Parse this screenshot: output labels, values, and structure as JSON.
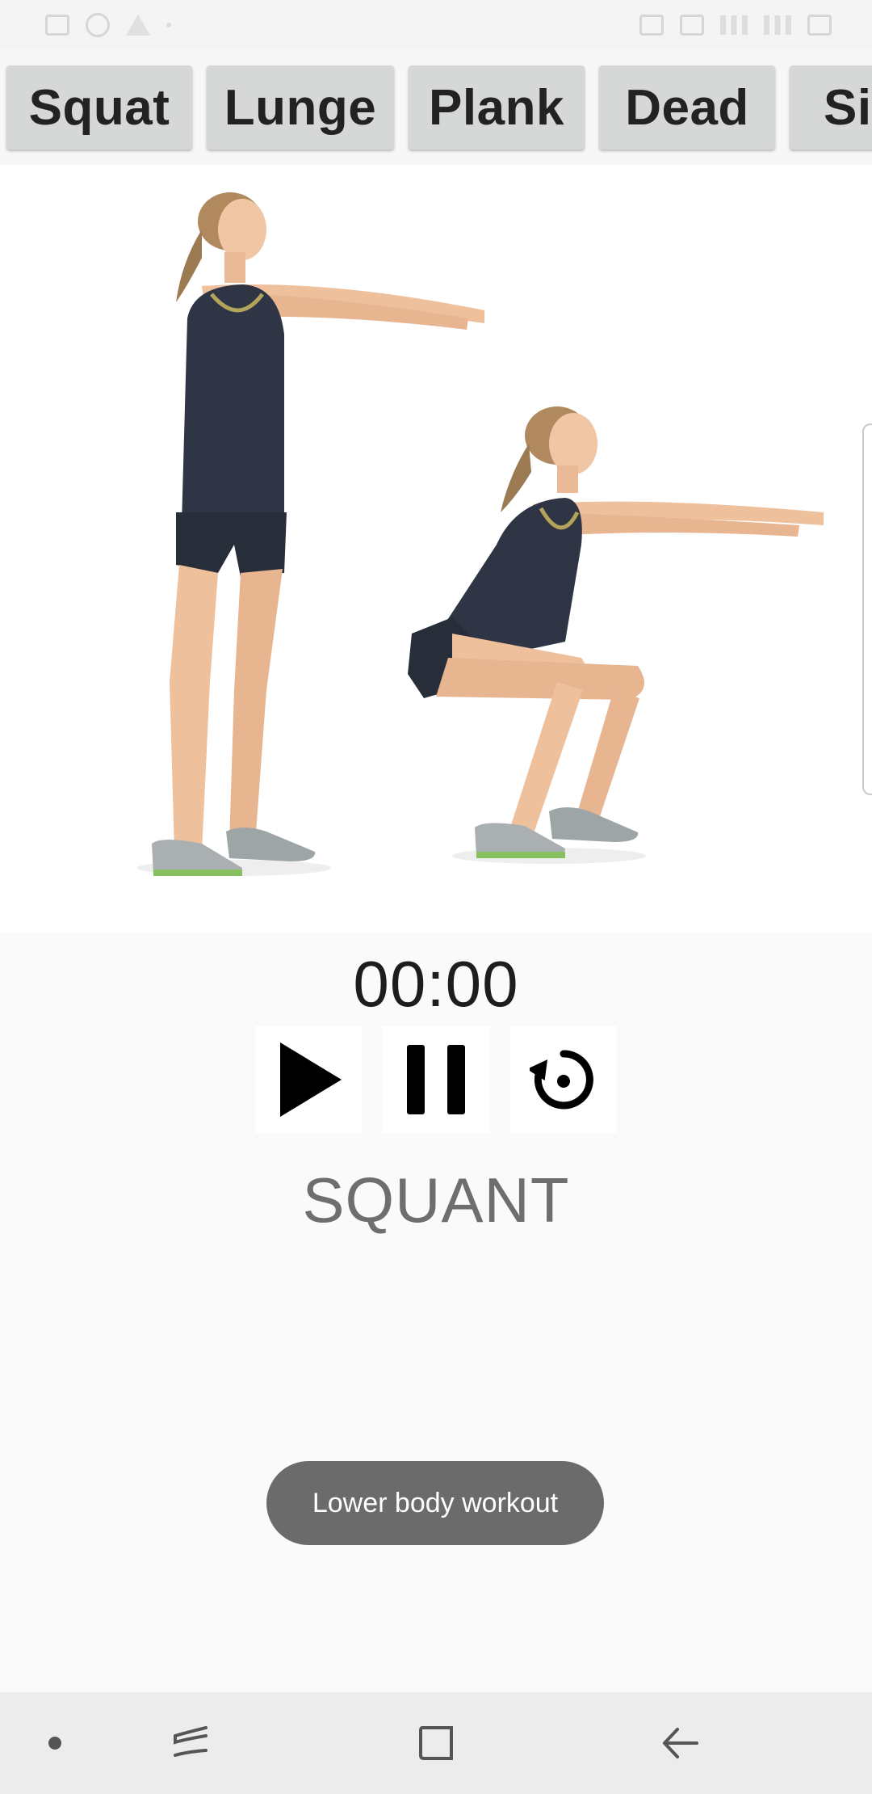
{
  "tabs": [
    {
      "label": "Squat"
    },
    {
      "label": "Lunge"
    },
    {
      "label": "Plank"
    },
    {
      "label": "Dead"
    },
    {
      "label": "Si"
    }
  ],
  "timer": {
    "value": "00:00"
  },
  "controls": {
    "play_icon": "play-icon",
    "pause_icon": "pause-icon",
    "reset_icon": "reset-icon"
  },
  "exercise": {
    "name": "SQUANT"
  },
  "toast": {
    "text": "Lower body workout"
  },
  "colors": {
    "background": "#fafafa",
    "tab_background": "#d6d7d7",
    "toast_background": "#6b6b6b",
    "exercise_name": "#6e6e6e"
  }
}
